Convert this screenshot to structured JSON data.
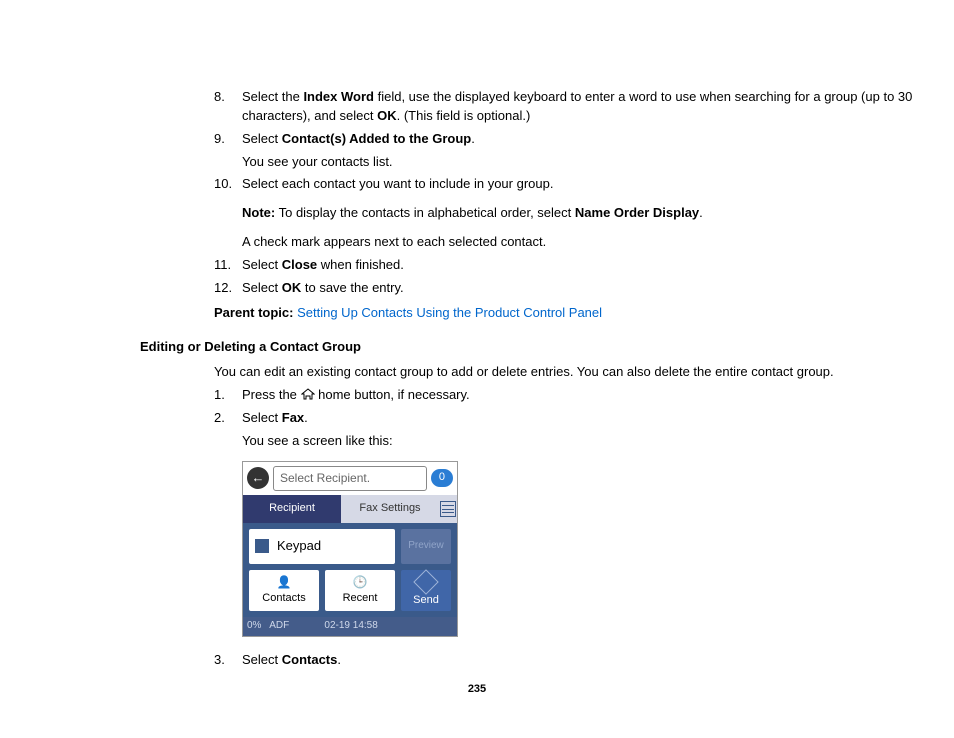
{
  "steps_a": [
    {
      "num": "8.",
      "parts": [
        {
          "t": "Select the "
        },
        {
          "t": "Index Word",
          "b": true
        },
        {
          "t": " field, use the displayed keyboard to enter a word to use when searching for a group (up to 30 characters), and select "
        },
        {
          "t": "OK",
          "b": true
        },
        {
          "t": ". (This field is optional.)"
        }
      ]
    },
    {
      "num": "9.",
      "parts": [
        {
          "t": "Select "
        },
        {
          "t": "Contact(s) Added to the Group",
          "b": true
        },
        {
          "t": "."
        }
      ],
      "after": "You see your contacts list."
    },
    {
      "num": "10.",
      "parts": [
        {
          "t": "Select each contact you want to include in your group."
        }
      ],
      "note_parts": [
        {
          "t": "Note:",
          "b": true
        },
        {
          "t": " To display the contacts in alphabetical order, select "
        },
        {
          "t": "Name Order Display",
          "b": true
        },
        {
          "t": "."
        }
      ],
      "after2": "A check mark appears next to each selected contact."
    },
    {
      "num": "11.",
      "parts": [
        {
          "t": "Select "
        },
        {
          "t": "Close",
          "b": true
        },
        {
          "t": " when finished."
        }
      ]
    },
    {
      "num": "12.",
      "parts": [
        {
          "t": "Select "
        },
        {
          "t": "OK",
          "b": true
        },
        {
          "t": " to save the entry."
        }
      ]
    }
  ],
  "parent_label": "Parent topic:",
  "parent_link": "Setting Up Contacts Using the Product Control Panel",
  "heading": "Editing or Deleting a Contact Group",
  "intro": "You can edit an existing contact group to add or delete entries. You can also delete the entire contact group.",
  "steps_b": [
    {
      "num": "1.",
      "parts": [
        {
          "t": "Press the "
        },
        {
          "icon": "home"
        },
        {
          "t": " home button, if necessary."
        }
      ]
    },
    {
      "num": "2.",
      "parts": [
        {
          "t": "Select "
        },
        {
          "t": "Fax",
          "b": true
        },
        {
          "t": "."
        }
      ],
      "after": "You see a screen like this:"
    },
    {
      "num": "3.",
      "parts": [
        {
          "t": "Select "
        },
        {
          "t": "Contacts",
          "b": true
        },
        {
          "t": "."
        }
      ]
    }
  ],
  "screen": {
    "placeholder": "Select Recipient.",
    "badge": "0",
    "tab_recipient": "Recipient",
    "tab_fax": "Fax Settings",
    "keypad": "Keypad",
    "preview": "Preview",
    "contacts": "Contacts",
    "recent": "Recent",
    "send": "Send",
    "pct": "0%",
    "adf": "ADF",
    "time": "02-19 14:58"
  },
  "page_number": "235"
}
